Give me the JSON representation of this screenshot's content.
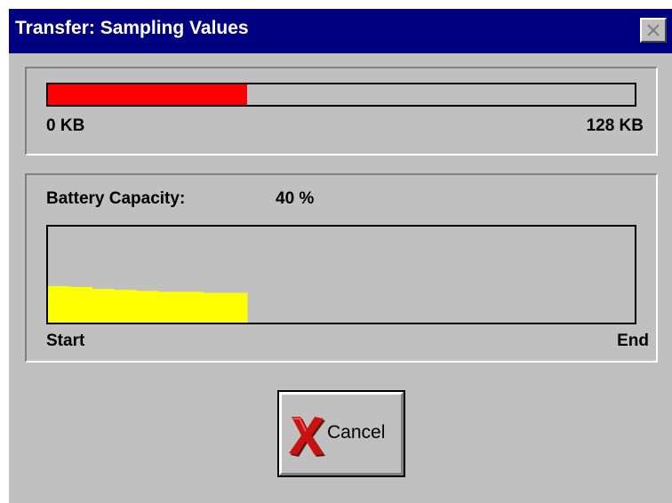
{
  "window": {
    "title": "Transfer: Sampling Values",
    "colors": {
      "titlebar": "#000080",
      "face": "#c0c0c0"
    }
  },
  "transfer": {
    "progress_fraction": 0.34,
    "fill_color": "#ff0000",
    "min_label": "0 KB",
    "max_label": "128 KB"
  },
  "battery": {
    "label": "Battery Capacity:",
    "value": "40 %",
    "fill_color": "#ffff00",
    "graph_levels": [
      0.38,
      0.37,
      0.35,
      0.34,
      0.33,
      0.32,
      0.32,
      0.31,
      0.31
    ],
    "graph_fraction_of_time": 0.34,
    "start_label": "Start",
    "end_label": "End"
  },
  "actions": {
    "cancel_label": "Cancel",
    "cancel_icon": "red-x-icon"
  }
}
